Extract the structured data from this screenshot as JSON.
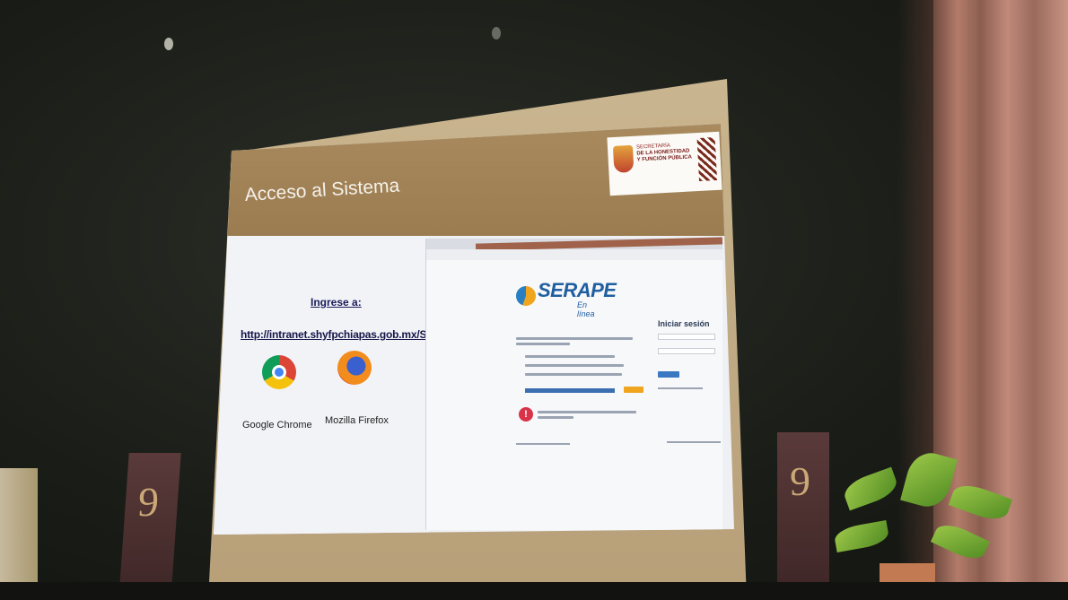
{
  "slide": {
    "title": "Acceso al Sistema",
    "logo_lines": [
      "SECRETARÍA",
      "DE LA HONESTIDAD",
      "Y FUNCIÓN PÚBLICA"
    ],
    "ingrese": "Ingrese a:",
    "url": "http://intranet.shyfpchiapas.gob.mx/Serape",
    "browsers": [
      {
        "icon": "chrome-icon",
        "label": "Google Chrome"
      },
      {
        "icon": "firefox-icon",
        "label": "Mozilla Firefox"
      }
    ],
    "screenshot": {
      "app_name": "SERAPE",
      "app_tagline": "En línea",
      "login_title": "Iniciar sesión"
    }
  },
  "banners": {
    "number": "9"
  },
  "colors": {
    "slide_header": "#a88a5e",
    "accent_maroon": "#7a1a1a",
    "serape_blue": "#1f5fa0",
    "serape_orange": "#f0a51e"
  }
}
